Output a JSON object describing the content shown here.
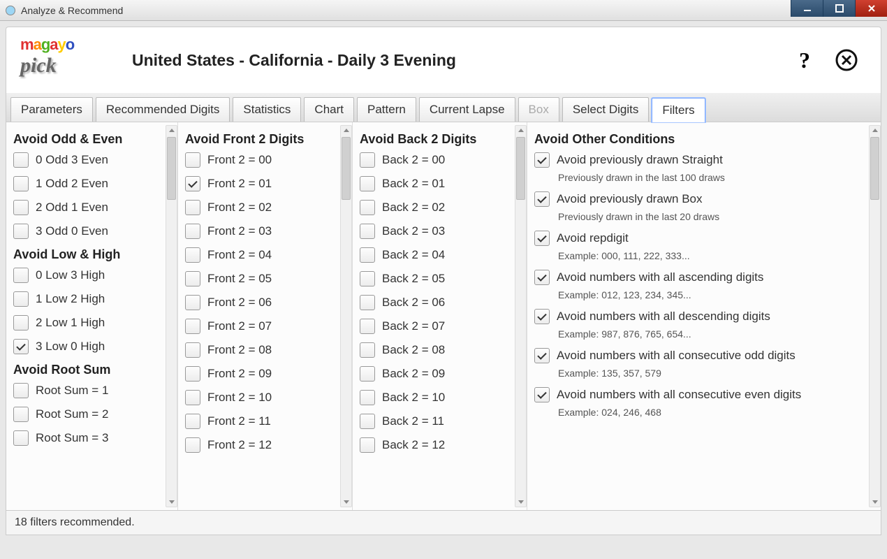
{
  "window": {
    "title": "Analyze & Recommend"
  },
  "header": {
    "title": "United States - California - Daily 3 Evening"
  },
  "tabs": [
    {
      "label": "Parameters",
      "mode": "normal"
    },
    {
      "label": "Recommended Digits",
      "mode": "normal"
    },
    {
      "label": "Statistics",
      "mode": "normal"
    },
    {
      "label": "Chart",
      "mode": "normal"
    },
    {
      "label": "Pattern",
      "mode": "normal"
    },
    {
      "label": "Current Lapse",
      "mode": "normal"
    },
    {
      "label": "Box",
      "mode": "disabled"
    },
    {
      "label": "Select Digits",
      "mode": "normal"
    },
    {
      "label": "Filters",
      "mode": "active"
    }
  ],
  "column1": {
    "sections": [
      {
        "heading": "Avoid Odd & Even",
        "items": [
          {
            "label": "0 Odd 3 Even",
            "checked": false
          },
          {
            "label": "1 Odd 2 Even",
            "checked": false
          },
          {
            "label": "2 Odd 1 Even",
            "checked": false
          },
          {
            "label": "3 Odd 0 Even",
            "checked": false
          }
        ]
      },
      {
        "heading": "Avoid Low & High",
        "items": [
          {
            "label": "0 Low 3 High",
            "checked": false
          },
          {
            "label": "1 Low 2 High",
            "checked": false
          },
          {
            "label": "2 Low 1 High",
            "checked": false
          },
          {
            "label": "3 Low 0 High",
            "checked": true
          }
        ]
      },
      {
        "heading": "Avoid Root Sum",
        "items": [
          {
            "label": "Root Sum = 1",
            "checked": false
          },
          {
            "label": "Root Sum = 2",
            "checked": false
          },
          {
            "label": "Root Sum = 3",
            "checked": false
          }
        ]
      }
    ]
  },
  "column2": {
    "heading": "Avoid Front 2 Digits",
    "items": [
      {
        "label": "Front 2 = 00",
        "checked": false
      },
      {
        "label": "Front 2 = 01",
        "checked": true
      },
      {
        "label": "Front 2 = 02",
        "checked": false
      },
      {
        "label": "Front 2 = 03",
        "checked": false
      },
      {
        "label": "Front 2 = 04",
        "checked": false
      },
      {
        "label": "Front 2 = 05",
        "checked": false
      },
      {
        "label": "Front 2 = 06",
        "checked": false
      },
      {
        "label": "Front 2 = 07",
        "checked": false
      },
      {
        "label": "Front 2 = 08",
        "checked": false
      },
      {
        "label": "Front 2 = 09",
        "checked": false
      },
      {
        "label": "Front 2 = 10",
        "checked": false
      },
      {
        "label": "Front 2 = 11",
        "checked": false
      },
      {
        "label": "Front 2 = 12",
        "checked": false
      }
    ]
  },
  "column3": {
    "heading": "Avoid Back 2 Digits",
    "items": [
      {
        "label": "Back 2 = 00",
        "checked": false
      },
      {
        "label": "Back 2 = 01",
        "checked": false
      },
      {
        "label": "Back 2 = 02",
        "checked": false
      },
      {
        "label": "Back 2 = 03",
        "checked": false
      },
      {
        "label": "Back 2 = 04",
        "checked": false
      },
      {
        "label": "Back 2 = 05",
        "checked": false
      },
      {
        "label": "Back 2 = 06",
        "checked": false
      },
      {
        "label": "Back 2 = 07",
        "checked": false
      },
      {
        "label": "Back 2 = 08",
        "checked": false
      },
      {
        "label": "Back 2 = 09",
        "checked": false
      },
      {
        "label": "Back 2 = 10",
        "checked": false
      },
      {
        "label": "Back 2 = 11",
        "checked": false
      },
      {
        "label": "Back 2 = 12",
        "checked": false
      }
    ]
  },
  "column4": {
    "heading": "Avoid Other Conditions",
    "items": [
      {
        "label": "Avoid previously drawn Straight",
        "checked": true,
        "sub": "Previously drawn in the last 100 draws"
      },
      {
        "label": "Avoid previously drawn Box",
        "checked": true,
        "sub": "Previously drawn in the last 20 draws"
      },
      {
        "label": "Avoid repdigit",
        "checked": true,
        "sub": "Example: 000, 111, 222, 333..."
      },
      {
        "label": "Avoid numbers with all ascending digits",
        "checked": true,
        "sub": "Example: 012, 123, 234, 345..."
      },
      {
        "label": "Avoid numbers with all descending digits",
        "checked": true,
        "sub": "Example: 987, 876, 765, 654..."
      },
      {
        "label": "Avoid numbers with all consecutive odd digits",
        "checked": true,
        "sub": "Example: 135, 357, 579"
      },
      {
        "label": "Avoid numbers with all consecutive even digits",
        "checked": true,
        "sub": "Example: 024, 246, 468"
      }
    ]
  },
  "status": {
    "text": "18 filters recommended."
  }
}
